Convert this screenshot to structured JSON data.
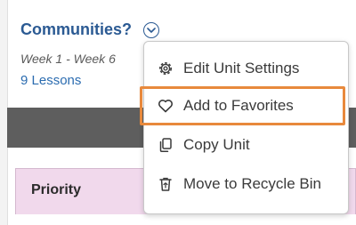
{
  "unit": {
    "title": "Communities?",
    "weeks": "Week 1 - Week 6",
    "lessons": "9 Lessons"
  },
  "table": {
    "header_label": "Priority"
  },
  "context_menu": {
    "items": [
      {
        "label": "Edit Unit Settings",
        "icon": "gear-icon"
      },
      {
        "label": "Add to Favorites",
        "icon": "heart-icon"
      },
      {
        "label": "Copy Unit",
        "icon": "copy-icon"
      },
      {
        "label": "Move to Recycle Bin",
        "icon": "recycle-bin-icon"
      }
    ]
  },
  "colors": {
    "link_blue": "#2b5a93",
    "highlight_orange": "#e8893c",
    "priority_bg": "#f1d9ec",
    "dark_band": "#5e5e5e"
  }
}
